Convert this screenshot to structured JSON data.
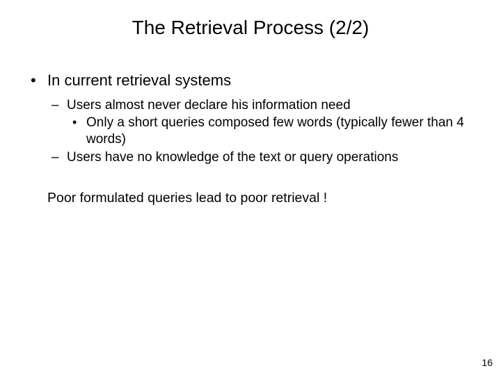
{
  "title": "The Retrieval Process (2/2)",
  "bullets": [
    {
      "text": "In current retrieval systems",
      "children": [
        {
          "text": "Users almost never declare his information need",
          "children": [
            {
              "text": "Only a short queries composed few words (typically fewer than 4 words)"
            }
          ]
        },
        {
          "text": "Users have no knowledge of the text or query operations"
        }
      ]
    }
  ],
  "conclusion": "Poor formulated queries lead to poor retrieval !",
  "page_number": "16"
}
